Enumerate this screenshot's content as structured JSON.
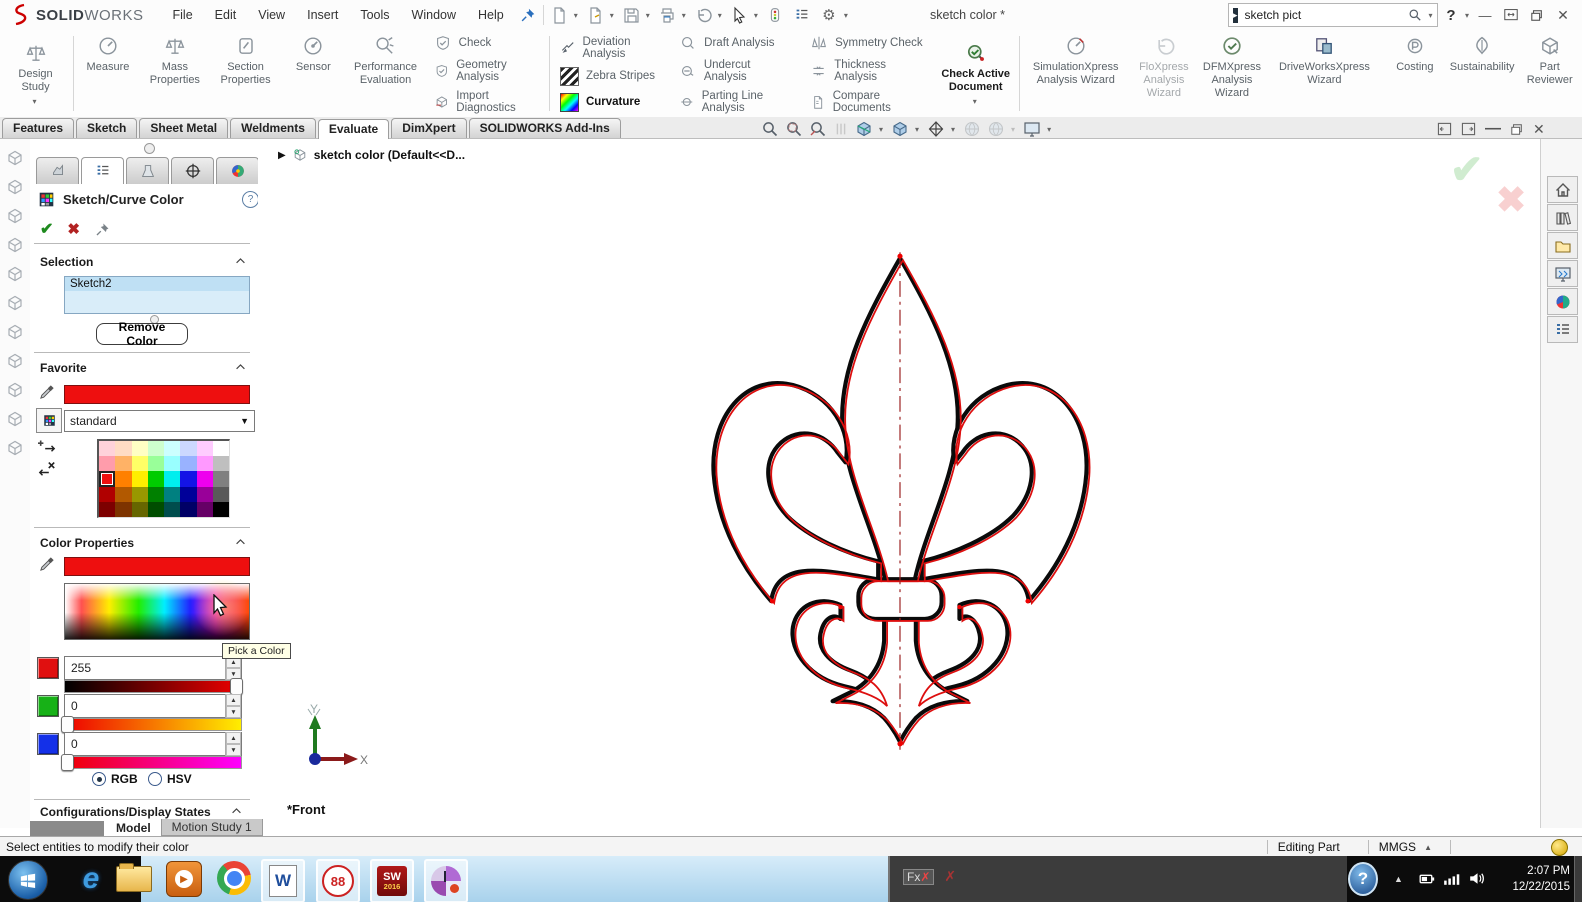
{
  "titlebar": {
    "brand_bold": "SOLID",
    "brand_light": "WORKS",
    "menus": [
      "File",
      "Edit",
      "View",
      "Insert",
      "Tools",
      "Window",
      "Help"
    ],
    "doc_title": "sketch color *",
    "search_value": "sketch pict",
    "help_label": "?"
  },
  "ribbon": {
    "design_study": "Design Study",
    "row": [
      "Measure",
      "Mass Properties",
      "Section Properties",
      "Sensor",
      "Performance Evaluation"
    ],
    "stack1": [
      "Check",
      "Geometry Analysis",
      "Import Diagnostics"
    ],
    "stack2": [
      "Deviation Analysis",
      "Zebra Stripes",
      "Curvature"
    ],
    "stack3": [
      "Draft Analysis",
      "Undercut Analysis",
      "Parting Line Analysis"
    ],
    "stack4": [
      "Symmetry Check",
      "Thickness Analysis",
      "Compare Documents"
    ],
    "check_active": "Check Active Document",
    "wizards": [
      "SimulationXpress Analysis Wizard",
      "FloXpress Analysis Wizard",
      "DFMXpress Analysis Wizard",
      "DriveWorksXpress Wizard",
      "Costing",
      "Sustainability",
      "Part Reviewer"
    ]
  },
  "tabs": {
    "items": [
      "Features",
      "Sketch",
      "Sheet Metal",
      "Weldments",
      "Evaluate",
      "DimXpert",
      "SOLIDWORKS Add-Ins"
    ],
    "active": "Evaluate"
  },
  "breadcrumb": "sketch color  (Default<<D...",
  "panel": {
    "title": "Sketch/Curve Color",
    "selection": {
      "header": "Selection",
      "item": "Sketch2",
      "remove": "Remove Color"
    },
    "favorite": {
      "header": "Favorite",
      "dropdown": "standard"
    },
    "color_props": {
      "header": "Color Properties",
      "r": "255",
      "g": "0",
      "b": "0",
      "rgb": "RGB",
      "hsv": "HSV",
      "tooltip": "Pick a Color"
    },
    "config_header": "Configurations/Display States"
  },
  "palette": {
    "selected": [
      2,
      0
    ],
    "rows": [
      [
        "#ffd2da",
        "#ffdcc4",
        "#ffffc4",
        "#ceffce",
        "#ccffff",
        "#ccd8ff",
        "#ffccff",
        "#ffffff"
      ],
      [
        "#ff9cab",
        "#ffb266",
        "#ffff66",
        "#99ff99",
        "#99ffff",
        "#99b2ff",
        "#ff99ff",
        "#bfbfbf"
      ],
      [
        "#ee0f0f",
        "#ff8000",
        "#ffee00",
        "#00cc00",
        "#00eeee",
        "#1414e6",
        "#ee00ee",
        "#808080"
      ],
      [
        "#b00000",
        "#b25900",
        "#989800",
        "#008000",
        "#008080",
        "#000099",
        "#990099",
        "#595959"
      ],
      [
        "#7d0000",
        "#7d3300",
        "#666600",
        "#004d00",
        "#004d4d",
        "#000066",
        "#660066",
        "#000000"
      ]
    ]
  },
  "viewport": {
    "plane": "*Front",
    "axis_x": "X",
    "axis_y": "Y"
  },
  "bottom": {
    "tab_model": "Model",
    "tab_motion": "Motion Study 1"
  },
  "status": {
    "message": "Select entities to modify their color",
    "mode": "Editing Part",
    "units": "MMGS"
  },
  "taskbar": {
    "time": "2:07 PM",
    "date": "12/22/2015",
    "ie_label": "e",
    "word_label": "W",
    "circles_label": "88",
    "sw_label": "SW",
    "sw_year": "2016",
    "fx_label": "Fx",
    "help_label": "?"
  },
  "colors": {
    "accent_red": "#ee0f0f",
    "selection_blue": "#d9edf9",
    "taskbar_blue": "#a9d2ec"
  }
}
